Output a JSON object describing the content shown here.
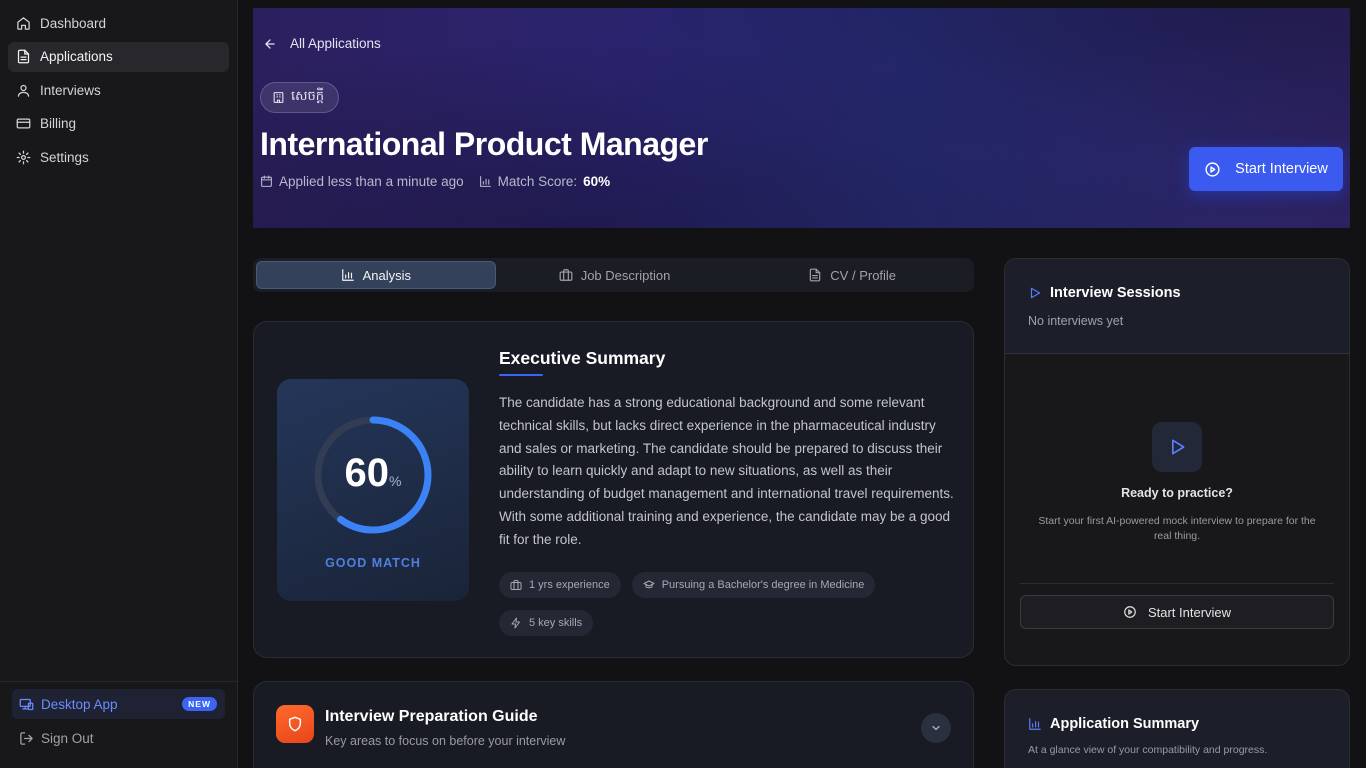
{
  "sidebar": {
    "items": [
      {
        "label": "Dashboard",
        "icon": "home-icon"
      },
      {
        "label": "Applications",
        "icon": "document-icon",
        "active": true
      },
      {
        "label": "Interviews",
        "icon": "user-icon"
      },
      {
        "label": "Billing",
        "icon": "credit-card-icon"
      },
      {
        "label": "Settings",
        "icon": "gear-icon"
      }
    ],
    "desktop_app": {
      "label": "Desktop App",
      "badge": "NEW"
    },
    "sign_out": "Sign Out"
  },
  "hero": {
    "back_label": "All Applications",
    "company": "សេចក្តី",
    "title": "International Product Manager",
    "applied": "Applied less than a minute ago",
    "match_label": "Match Score:",
    "match_value": "60%",
    "start_button": "Start Interview"
  },
  "tabs": [
    {
      "label": "Analysis",
      "active": true
    },
    {
      "label": "Job Description"
    },
    {
      "label": "CV / Profile"
    }
  ],
  "summary": {
    "title": "Executive Summary",
    "score": 60,
    "score_number": "60",
    "score_unit": "%",
    "score_label": "GOOD MATCH",
    "text": "The candidate has a strong educational background and some relevant technical skills, but lacks direct experience in the pharmaceutical industry and sales or marketing. The candidate should be prepared to discuss their ability to learn quickly and adapt to new situations, as well as their understanding of budget management and international travel requirements. With some additional training and experience, the candidate may be a good fit for the role.",
    "chips": [
      "1 yrs experience",
      "Pursuing a Bachelor's degree in Medicine",
      "5 key skills"
    ]
  },
  "prep": {
    "title": "Interview Preparation Guide",
    "subtitle": "Key areas to focus on before your interview"
  },
  "sessions": {
    "title": "Interview Sessions",
    "empty": "No interviews yet",
    "ready": "Ready to practice?",
    "ready_sub": "Start your first AI-powered mock interview to prepare for the real thing.",
    "start_button": "Start Interview"
  },
  "app_summary": {
    "title": "Application Summary",
    "subtitle": "At a glance view of your compatibility and progress."
  },
  "colors": {
    "accent": "#3b5bf0",
    "score_ring": "#3b82f6",
    "prep_icon": "#f25c24"
  }
}
